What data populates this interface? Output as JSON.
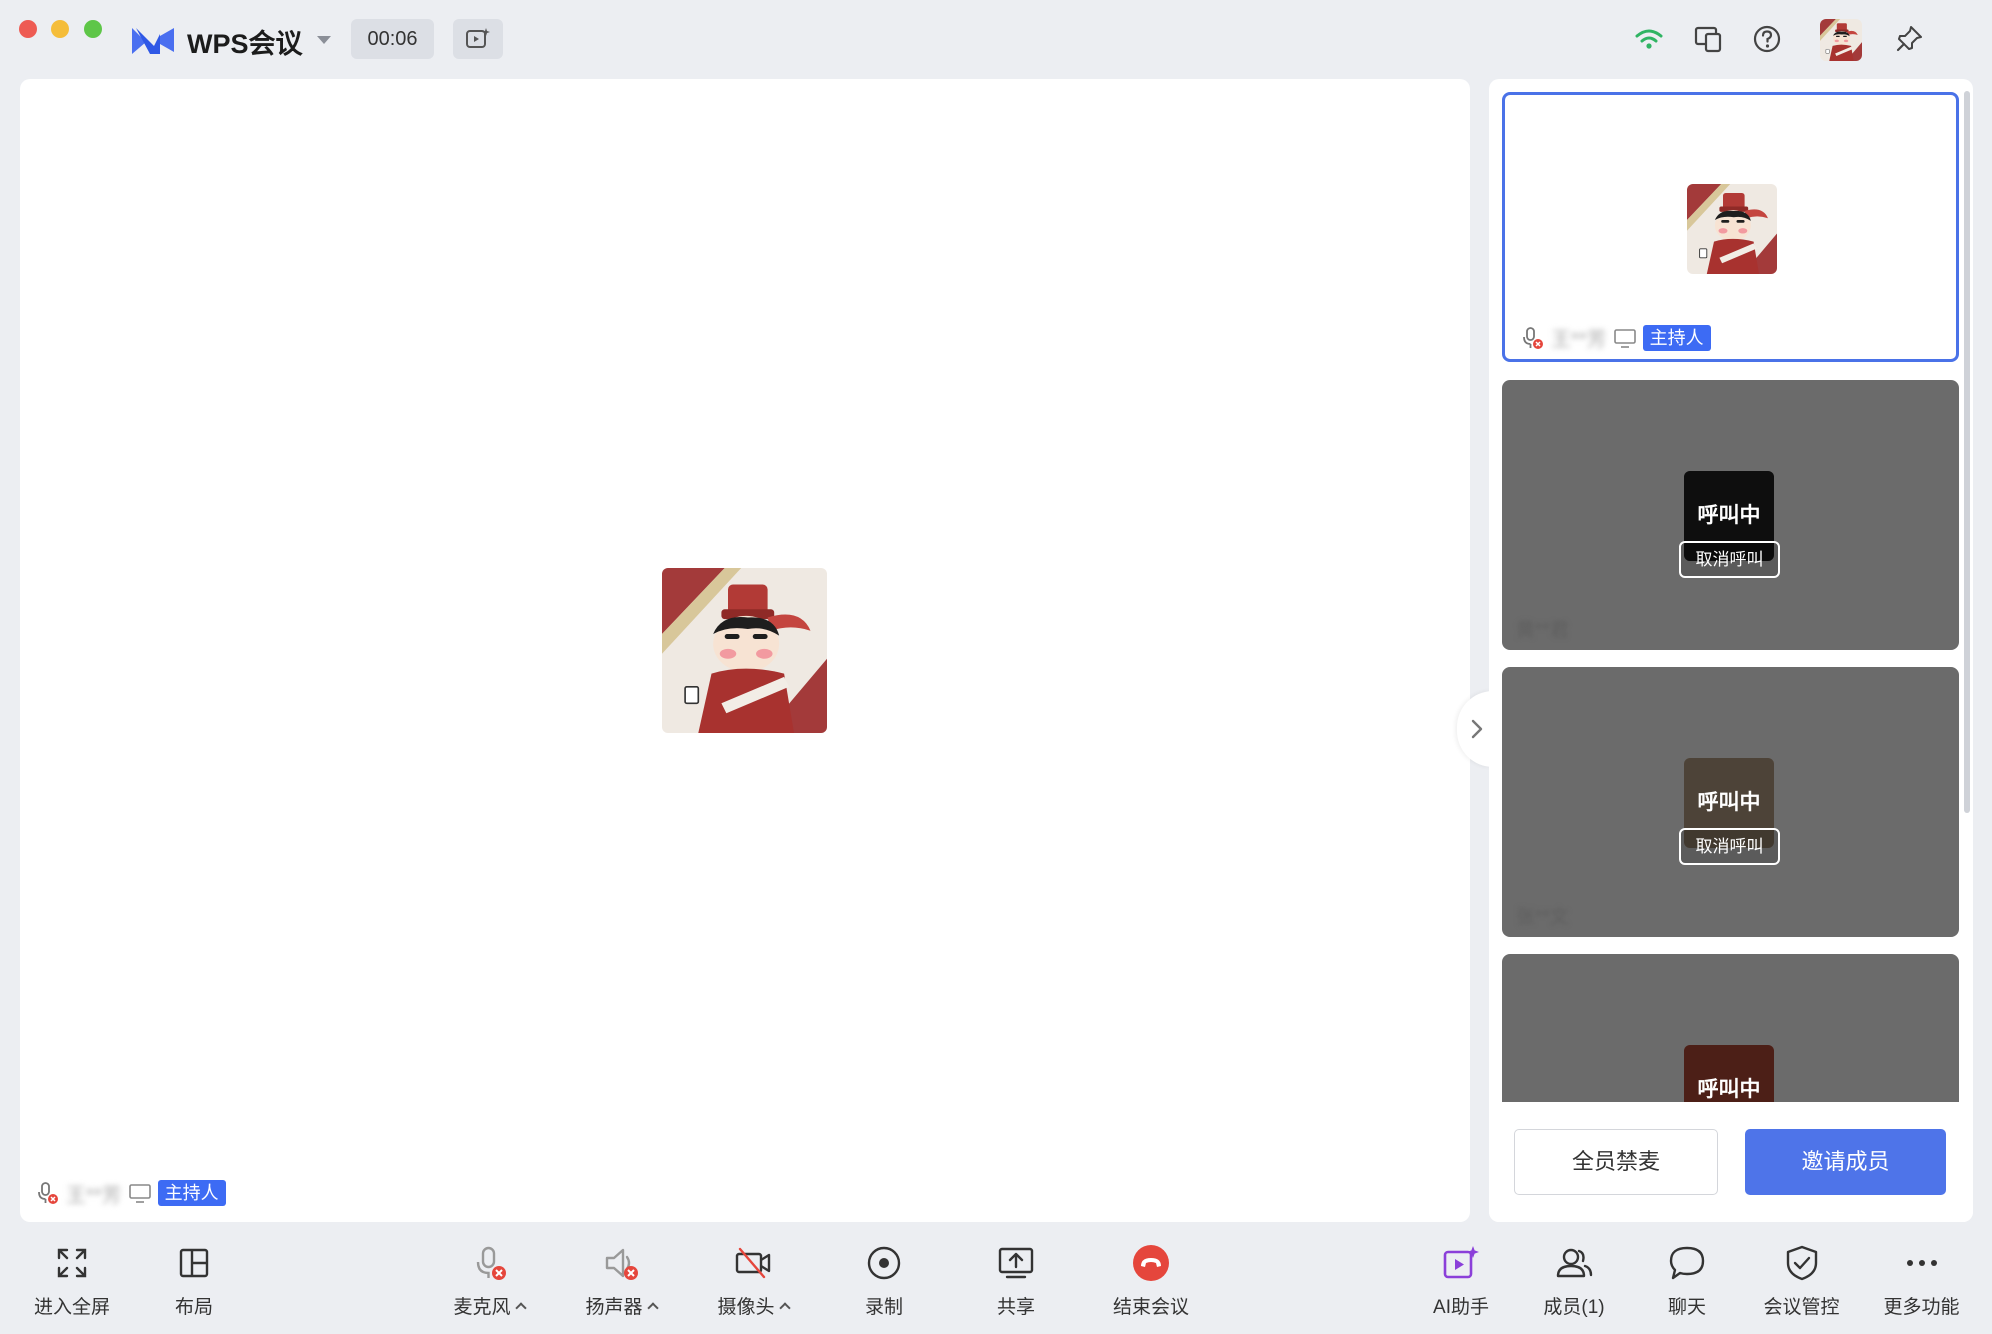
{
  "window": {
    "app_title": "WPS会议",
    "timer": "00:06"
  },
  "main": {
    "speaker_name": "王**芳",
    "host_badge": "主持人"
  },
  "side": {
    "self_tile": {
      "name": "王**芳",
      "host_badge": "主持人"
    },
    "calling_tiles": [
      {
        "status": "呼叫中",
        "cancel_label": "取消呼叫",
        "name": "黄**君"
      },
      {
        "status": "呼叫中",
        "cancel_label": "取消呼叫",
        "name": "张**文"
      },
      {
        "status": "呼叫中"
      }
    ],
    "mute_all_label": "全员禁麦",
    "invite_label": "邀请成员"
  },
  "toolbar": {
    "fullscreen": "进入全屏",
    "layout": "布局",
    "microphone": "麦克风",
    "speaker": "扬声器",
    "camera": "摄像头",
    "record": "录制",
    "share": "共享",
    "end_meeting": "结束会议",
    "ai_assistant": "AI助手",
    "members": "成员(1)",
    "chat": "聊天",
    "meeting_control": "会议管控",
    "more": "更多功能"
  },
  "colors": {
    "accent": "#4e74e9",
    "host_badge": "#3d6bf4",
    "end_call": "#e5463c",
    "ai_purple": "#8b3fd9",
    "wifi": "#2fb463"
  }
}
